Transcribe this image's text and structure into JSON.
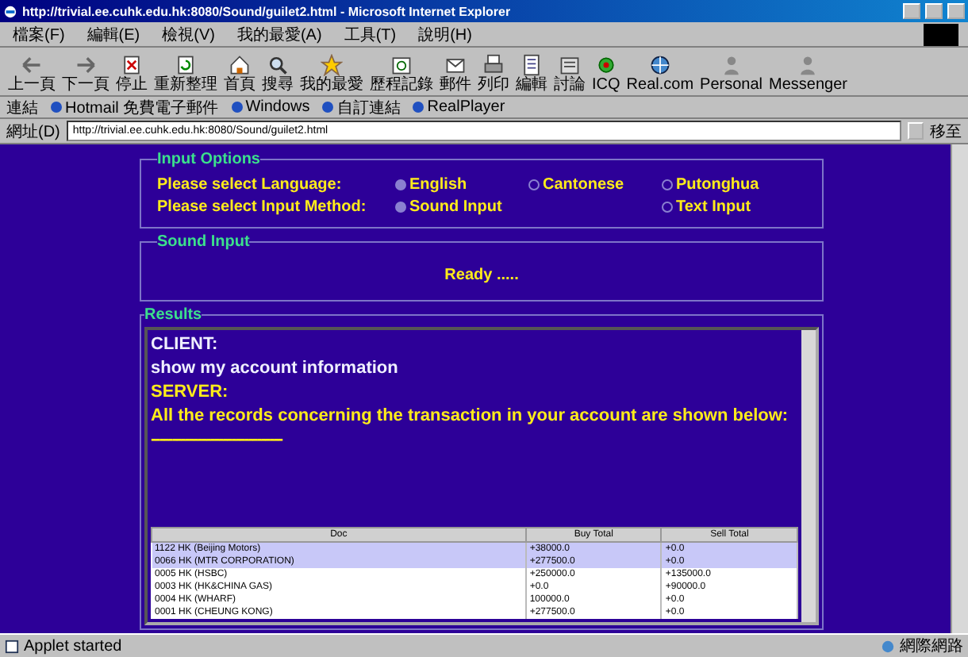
{
  "window": {
    "title": "http://trivial.ee.cuhk.edu.hk:8080/Sound/guilet2.html - Microsoft Internet Explorer"
  },
  "menu": [
    "檔案(F)",
    "編輯(E)",
    "檢視(V)",
    "我的最愛(A)",
    "工具(T)",
    "說明(H)"
  ],
  "toolbar": [
    "上一頁",
    "下一頁",
    "停止",
    "重新整理",
    "首頁",
    "搜尋",
    "我的最愛",
    "歷程記錄",
    "郵件",
    "列印",
    "編輯",
    "討論",
    "ICQ",
    "Real.com",
    "Personal",
    "Messenger"
  ],
  "links": {
    "label": "連結",
    "items": [
      "Hotmail 免費電子郵件",
      "Windows",
      "自訂連結",
      "RealPlayer"
    ]
  },
  "address": {
    "label": "網址(D)",
    "value": "http://trivial.ee.cuhk.edu.hk:8080/Sound/guilet2.html",
    "go": "移至"
  },
  "input_options": {
    "legend": "Input Options",
    "language": {
      "label": "Please select Language:",
      "options": [
        {
          "label": "English",
          "selected": true
        },
        {
          "label": "Cantonese",
          "selected": false
        },
        {
          "label": "Putonghua",
          "selected": false
        }
      ]
    },
    "method": {
      "label": "Please select Input Method:",
      "options": [
        {
          "label": "Sound Input",
          "selected": true
        },
        {
          "label": "Text Input",
          "selected": false
        }
      ]
    }
  },
  "sound_input": {
    "legend": "Sound Input",
    "status": "Ready ....."
  },
  "results": {
    "legend": "Results",
    "messages": [
      {
        "kind": "client",
        "text": "CLIENT:"
      },
      {
        "kind": "client",
        "text": "show my account information"
      },
      {
        "kind": "server",
        "text": "SERVER:"
      },
      {
        "kind": "server",
        "text": "All the records concerning the transaction in your account are shown below:"
      },
      {
        "kind": "server",
        "text": "-------------------------------"
      }
    ],
    "table": {
      "columns": [
        "Doc",
        "Buy Total",
        "Sell Total"
      ],
      "rows": [
        {
          "cells": [
            "1122 HK (Beijing Motors)",
            "+38000.0",
            "+0.0"
          ],
          "selected": true
        },
        {
          "cells": [
            "0066 HK (MTR CORPORATION)",
            "+277500.0",
            "+0.0"
          ],
          "selected": true
        },
        {
          "cells": [
            "0005 HK (HSBC)",
            "+250000.0",
            "+135000.0"
          ],
          "selected": false
        },
        {
          "cells": [
            "0003 HK (HK&CHINA GAS)",
            "+0.0",
            "+90000.0"
          ],
          "selected": false
        },
        {
          "cells": [
            "0004 HK (WHARF)",
            "100000.0",
            "+0.0"
          ],
          "selected": false
        },
        {
          "cells": [
            "0001 HK (CHEUNG KONG)",
            "+277500.0",
            "+0.0"
          ],
          "selected": false
        }
      ]
    }
  },
  "status_bar": {
    "text": "Applet started",
    "zone": "網際網路"
  }
}
